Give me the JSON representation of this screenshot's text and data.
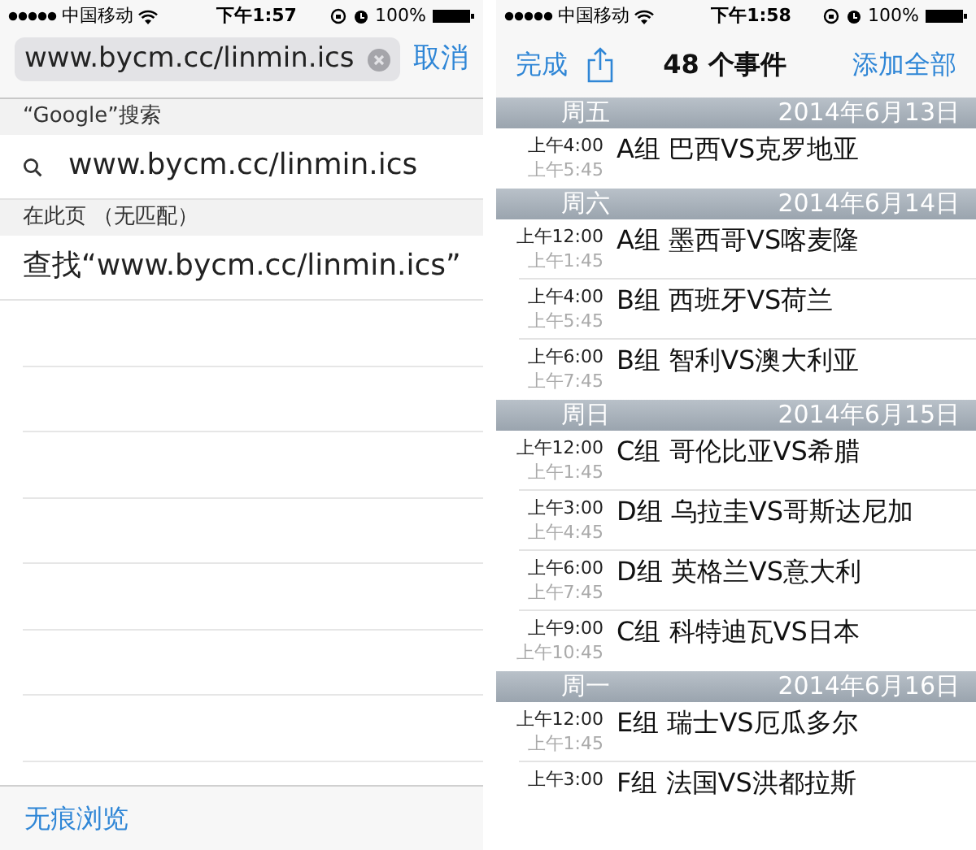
{
  "left": {
    "status_bar": {
      "carrier": "中国移动",
      "time": "下午1:57",
      "battery": "100%"
    },
    "search": {
      "value": "www.bycm.cc/linmin.ics",
      "cancel": "取消"
    },
    "sections": [
      {
        "header": "“Google”搜索",
        "items": [
          {
            "kind": "search",
            "text": "www.bycm.cc/linmin.ics"
          }
        ]
      },
      {
        "header": "在此页 （无匹配）",
        "items": [
          {
            "kind": "find",
            "text": "查找“www.bycm.cc/linmin.ics”"
          }
        ]
      }
    ],
    "bottom_bar": {
      "label": "无痕浏览"
    }
  },
  "right": {
    "status_bar": {
      "carrier": "中国移动",
      "time": "下午1:58",
      "battery": "100%"
    },
    "nav": {
      "done": "完成",
      "title": "48 个事件",
      "add_all": "添加全部"
    },
    "days": [
      {
        "weekday": "周五",
        "date": "2014年6月13日",
        "events": [
          {
            "start": "上午4:00",
            "end": "上午5:45",
            "title": "A组 巴西VS克罗地亚"
          }
        ]
      },
      {
        "weekday": "周六",
        "date": "2014年6月14日",
        "events": [
          {
            "start": "上午12:00",
            "end": "上午1:45",
            "title": "A组 墨西哥VS喀麦隆"
          },
          {
            "start": "上午4:00",
            "end": "上午5:45",
            "title": "B组 西班牙VS荷兰"
          },
          {
            "start": "上午6:00",
            "end": "上午7:45",
            "title": "B组 智利VS澳大利亚"
          }
        ]
      },
      {
        "weekday": "周日",
        "date": "2014年6月15日",
        "events": [
          {
            "start": "上午12:00",
            "end": "上午1:45",
            "title": "C组 哥伦比亚VS希腊"
          },
          {
            "start": "上午3:00",
            "end": "上午4:45",
            "title": "D组 乌拉圭VS哥斯达尼加"
          },
          {
            "start": "上午6:00",
            "end": "上午7:45",
            "title": "D组 英格兰VS意大利"
          },
          {
            "start": "上午9:00",
            "end": "上午10:45",
            "title": "C组 科特迪瓦VS日本"
          }
        ]
      },
      {
        "weekday": "周一",
        "date": "2014年6月16日",
        "events": [
          {
            "start": "上午12:00",
            "end": "上午1:45",
            "title": "E组 瑞士VS厄瓜多尔"
          },
          {
            "start": "上午3:00",
            "title": "F组 法国VS洪都拉斯"
          }
        ]
      }
    ]
  }
}
